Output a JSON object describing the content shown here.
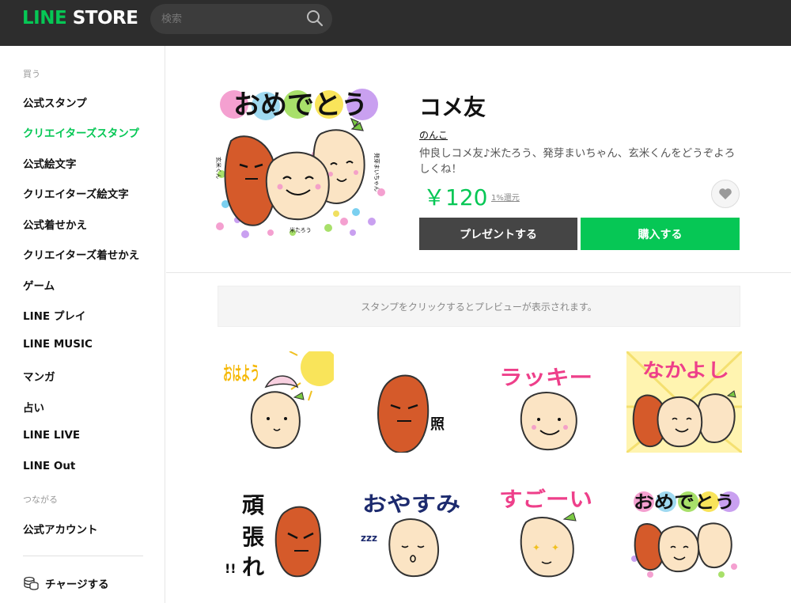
{
  "header": {
    "logo_line": "LINE",
    "logo_store": " STORE",
    "search_placeholder": "検索"
  },
  "sidebar": {
    "section_buy": "買う",
    "items": [
      "公式スタンプ",
      "クリエイターズスタンプ",
      "公式絵文字",
      "クリエイターズ絵文字",
      "公式着せかえ",
      "クリエイターズ着せかえ",
      "ゲーム",
      "LINE プレイ",
      "LINE MUSIC",
      "マンガ",
      "占い",
      "LINE LIVE",
      "LINE Out"
    ],
    "section_connect": "つながる",
    "official_account": "公式アカウント",
    "charge": "チャージする",
    "active_index": 1
  },
  "product": {
    "title": "コメ友",
    "author": "のんこ",
    "description": "仲良しコメ友♪米たろう、発芽まいちゃん、玄米くんをどうぞよろしくね！",
    "price": "￥120",
    "return_rate": "1%還元",
    "present_button": "プレゼントする",
    "buy_button": "購入する",
    "main_image": {
      "caption_top": "おめでとう",
      "label_genmai": "玄米くん",
      "label_kome": "米たろう",
      "label_hatsuga": "発芽まいちゃん"
    }
  },
  "preview_hint": "スタンプをクリックするとプレビューが表示されます。",
  "stickers": [
    {
      "text": "おはよう",
      "sound": ""
    },
    {
      "text": "",
      "sound": "照"
    },
    {
      "text": "ラッキー",
      "sound": ""
    },
    {
      "text": "なかよし",
      "sound": ""
    },
    {
      "text": "頑張れ",
      "sound": "!!"
    },
    {
      "text": "おやすみ",
      "sound": "zzz"
    },
    {
      "text": "すごーい",
      "sound": ""
    },
    {
      "text": "おめでとう",
      "sound": ""
    }
  ],
  "colors": {
    "brand_green": "#06c755",
    "header_bg": "#2d2d2d",
    "present_bg": "#454545"
  },
  "icons": [
    "search-icon",
    "heart-icon",
    "coin-stack-icon"
  ]
}
